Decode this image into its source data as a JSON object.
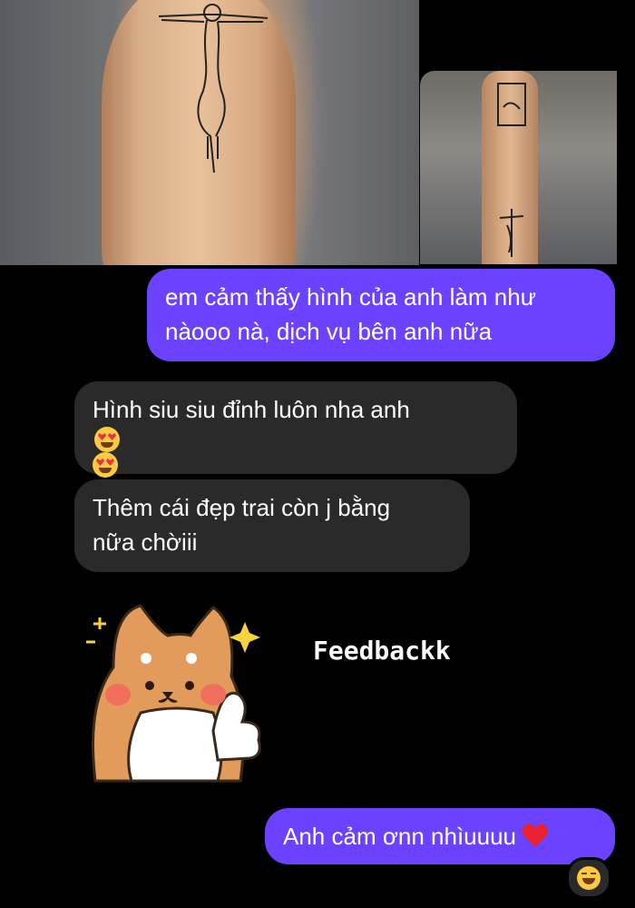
{
  "messages": {
    "outgoing_1_line1": "em cảm thấy hình của anh làm như",
    "outgoing_1_line2": "nàooo nà, dịch vụ bên anh nữa",
    "incoming_1_line1": "Hình siu siu đỉnh luôn nha anh",
    "incoming_2_line1": "Thêm cái đẹp trai còn j bằng",
    "incoming_2_line2": "nữa chờiii",
    "outgoing_2": "Anh cảm ơnn nhìuuuu"
  },
  "overlay": {
    "feedback_text": "Feedbackk"
  },
  "colors": {
    "outgoing_bubble": "#6a42ff",
    "incoming_bubble": "#2a2a2a",
    "background": "#000000"
  },
  "icons": {
    "heart": "red-heart-icon",
    "heart_eyes": "heart-eyes-emoji-icon",
    "reaction": "grinning-squint-emoji-icon",
    "sticker": "shiba-dog-thumbs-up-sticker"
  }
}
